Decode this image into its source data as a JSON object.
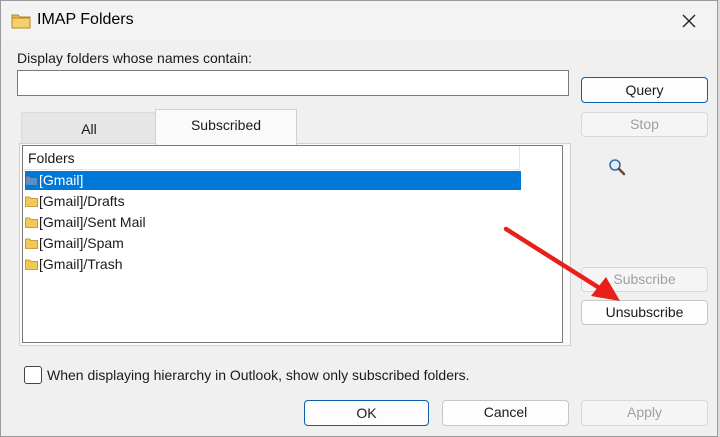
{
  "window": {
    "title": "IMAP Folders",
    "close_icon": "close-icon",
    "folder_icon": "folder-icon"
  },
  "filter": {
    "label": "Display folders whose names contain:",
    "value": "",
    "placeholder": ""
  },
  "tabs": [
    {
      "label": "All",
      "selected": false
    },
    {
      "label": "Subscribed",
      "selected": true
    }
  ],
  "list": {
    "header": "Folders",
    "items": [
      {
        "label": "[Gmail]",
        "selected": true
      },
      {
        "label": "[Gmail]/Drafts",
        "selected": false
      },
      {
        "label": "[Gmail]/Sent Mail",
        "selected": false
      },
      {
        "label": "[Gmail]/Spam",
        "selected": false
      },
      {
        "label": "[Gmail]/Trash",
        "selected": false
      }
    ]
  },
  "side_buttons": {
    "query": "Query",
    "stop": "Stop",
    "subscribe": "Subscribe",
    "unsubscribe": "Unsubscribe"
  },
  "option": {
    "label": "When displaying hierarchy in Outlook, show only subscribed folders.",
    "checked": false
  },
  "footer": {
    "ok": "OK",
    "cancel": "Cancel",
    "apply": "Apply"
  },
  "colors": {
    "selection": "#0078d7",
    "annotation_arrow": "#e8201a",
    "primary_border": "#0a5fb0"
  }
}
